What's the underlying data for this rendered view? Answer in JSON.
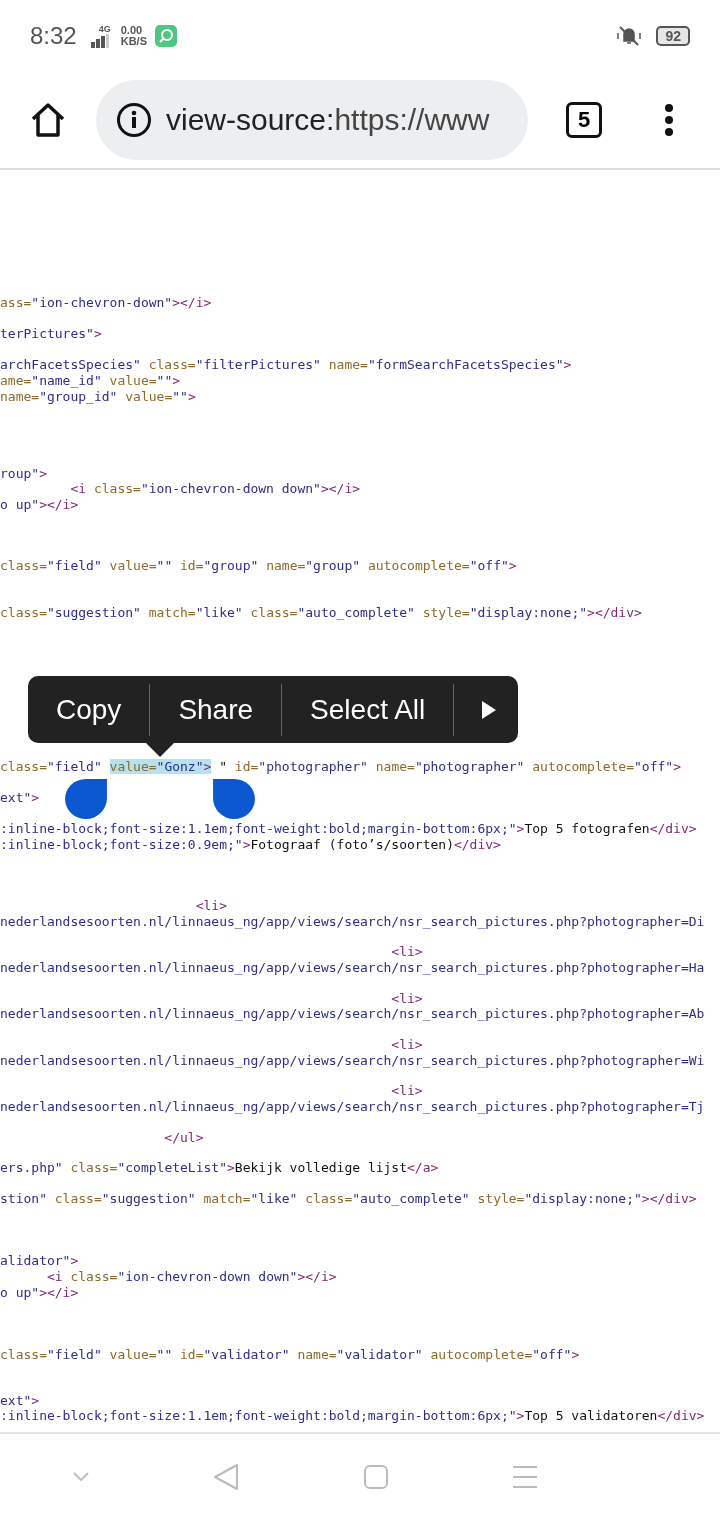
{
  "status_bar": {
    "time": "8:32",
    "network": "4G",
    "speed_value": "0.00",
    "speed_unit": "KB/S",
    "battery": "92"
  },
  "toolbar": {
    "url_scheme": "view-source:",
    "url_rest": "https://www",
    "tab_count": "5"
  },
  "source_lines": [
    {
      "segments": [
        {
          "kind": "attr",
          "text": "ass="
        },
        {
          "kind": "value",
          "text": "\"ion-chevron-down\""
        },
        {
          "kind": "tag",
          "text": "></i>"
        }
      ]
    },
    {
      "segments": [
        {
          "kind": "value",
          "text": "terPictures\""
        },
        {
          "kind": "tag",
          "text": ">"
        }
      ]
    },
    {
      "segments": [
        {
          "kind": "value",
          "text": "archFacetsSpecies\""
        },
        {
          "kind": "attr",
          "text": " class="
        },
        {
          "kind": "value",
          "text": "\"filterPictures\""
        },
        {
          "kind": "attr",
          "text": " name="
        },
        {
          "kind": "value",
          "text": "\"formSearchFacetsSpecies\""
        },
        {
          "kind": "tag",
          "text": ">"
        }
      ]
    },
    {
      "segments": [
        {
          "kind": "attr",
          "text": "ame="
        },
        {
          "kind": "value",
          "text": "\"name_id\""
        },
        {
          "kind": "attr",
          "text": " value="
        },
        {
          "kind": "value",
          "text": "\"\""
        },
        {
          "kind": "tag",
          "text": ">"
        }
      ]
    },
    {
      "segments": [
        {
          "kind": "attr",
          "text": "name="
        },
        {
          "kind": "value",
          "text": "\"group_id\""
        },
        {
          "kind": "attr",
          "text": " value="
        },
        {
          "kind": "value",
          "text": "\"\""
        },
        {
          "kind": "tag",
          "text": ">"
        }
      ]
    },
    {
      "segments": [
        {
          "kind": "value",
          "text": "roup\""
        },
        {
          "kind": "tag",
          "text": ">"
        }
      ]
    },
    {
      "segments": [
        {
          "kind": "tag",
          "text": "         <i"
        },
        {
          "kind": "attr",
          "text": " class="
        },
        {
          "kind": "value",
          "text": "\"ion-chevron-down down\""
        },
        {
          "kind": "tag",
          "text": "></i>"
        }
      ]
    },
    {
      "segments": [
        {
          "kind": "value",
          "text": "o up\""
        },
        {
          "kind": "tag",
          "text": "></i>"
        }
      ]
    },
    {
      "segments": [
        {
          "kind": "attr",
          "text": "class="
        },
        {
          "kind": "value",
          "text": "\"field\""
        },
        {
          "kind": "attr",
          "text": " value="
        },
        {
          "kind": "value",
          "text": "\"\""
        },
        {
          "kind": "attr",
          "text": " id="
        },
        {
          "kind": "value",
          "text": "\"group\""
        },
        {
          "kind": "attr",
          "text": " name="
        },
        {
          "kind": "value",
          "text": "\"group\""
        },
        {
          "kind": "attr",
          "text": " autocomplete="
        },
        {
          "kind": "value",
          "text": "\"off\""
        },
        {
          "kind": "tag",
          "text": ">"
        }
      ]
    },
    {
      "segments": [
        {
          "kind": "attr",
          "text": "class="
        },
        {
          "kind": "value",
          "text": "\"suggestion\""
        },
        {
          "kind": "attr",
          "text": " match="
        },
        {
          "kind": "value",
          "text": "\"like\""
        },
        {
          "kind": "attr",
          "text": " class="
        },
        {
          "kind": "value",
          "text": "\"auto_complete\""
        },
        {
          "kind": "attr",
          "text": " style="
        },
        {
          "kind": "value",
          "text": "\"display:none;\""
        },
        {
          "kind": "tag",
          "text": "></div>"
        }
      ]
    },
    {
      "segments": [
        {
          "kind": "attr",
          "text": "class=",
          "selected": false
        },
        {
          "kind": "value",
          "text": "\"field\" ",
          "selected": false
        },
        {
          "kind": "attr",
          "text": "value=",
          "selected": true
        },
        {
          "kind": "value",
          "text": "\"Gonz\"",
          "selected": true
        },
        {
          "kind": "tag",
          "text": ">",
          "selected": true
        },
        {
          "kind": "text",
          "text": " \" ",
          "selected": false
        },
        {
          "kind": "attr",
          "text": "id=",
          "selected": false
        },
        {
          "kind": "value",
          "text": "\"photographer\"",
          "selected": false
        },
        {
          "kind": "attr",
          "text": " name=",
          "selected": false
        },
        {
          "kind": "value",
          "text": "\"photographer\"",
          "selected": false
        },
        {
          "kind": "attr",
          "text": " autocomplete=",
          "selected": false
        },
        {
          "kind": "value",
          "text": "\"off\"",
          "selected": false
        },
        {
          "kind": "tag",
          "text": ">",
          "selected": false
        }
      ]
    },
    {
      "segments": [
        {
          "kind": "value",
          "text": "ext\""
        },
        {
          "kind": "tag",
          "text": ">"
        }
      ]
    },
    {
      "segments": [
        {
          "kind": "value",
          "text": ":inline-block;font-size:1.1em;font-weight:bold;margin-bottom:6px;\""
        },
        {
          "kind": "tag",
          "text": ">"
        },
        {
          "kind": "text",
          "text": "Top 5 fotografen"
        },
        {
          "kind": "tag",
          "text": "</div>"
        }
      ]
    },
    {
      "segments": [
        {
          "kind": "value",
          "text": ":inline-block;font-size:0.9em;\""
        },
        {
          "kind": "tag",
          "text": ">"
        },
        {
          "kind": "text",
          "text": "Fotograaf (foto’s/soorten)"
        },
        {
          "kind": "tag",
          "text": "</div>"
        }
      ]
    },
    {
      "segments": [
        {
          "kind": "tag",
          "text": "                         <li>"
        }
      ]
    },
    {
      "segments": [
        {
          "kind": "value",
          "text": "nederlandsesoorten.nl/linnaeus_ng/app/views/search/nsr_search_pictures.php?photographer=Di"
        }
      ]
    },
    {
      "segments": [
        {
          "kind": "tag",
          "text": "                                                  <li>"
        }
      ]
    },
    {
      "segments": [
        {
          "kind": "value",
          "text": "nederlandsesoorten.nl/linnaeus_ng/app/views/search/nsr_search_pictures.php?photographer=Ha"
        }
      ]
    },
    {
      "segments": [
        {
          "kind": "tag",
          "text": "                                                  <li>"
        }
      ]
    },
    {
      "segments": [
        {
          "kind": "value",
          "text": "nederlandsesoorten.nl/linnaeus_ng/app/views/search/nsr_search_pictures.php?photographer=Ab"
        }
      ]
    },
    {
      "segments": [
        {
          "kind": "tag",
          "text": "                                                  <li>"
        }
      ]
    },
    {
      "segments": [
        {
          "kind": "value",
          "text": "nederlandsesoorten.nl/linnaeus_ng/app/views/search/nsr_search_pictures.php?photographer=Wi"
        }
      ]
    },
    {
      "segments": [
        {
          "kind": "tag",
          "text": "                                                  <li>"
        }
      ]
    },
    {
      "segments": [
        {
          "kind": "value",
          "text": "nederlandsesoorten.nl/linnaeus_ng/app/views/search/nsr_search_pictures.php?photographer=Tj"
        }
      ]
    },
    {
      "segments": [
        {
          "kind": "tag",
          "text": "                     </ul>"
        }
      ]
    },
    {
      "segments": [
        {
          "kind": "value",
          "text": "ers.php\""
        },
        {
          "kind": "attr",
          "text": " class="
        },
        {
          "kind": "value",
          "text": "\"completeList\""
        },
        {
          "kind": "tag",
          "text": ">"
        },
        {
          "kind": "text",
          "text": "Bekijk volledige lijst"
        },
        {
          "kind": "tag",
          "text": "</a>"
        }
      ]
    },
    {
      "segments": [
        {
          "kind": "value",
          "text": "stion\""
        },
        {
          "kind": "attr",
          "text": " class="
        },
        {
          "kind": "value",
          "text": "\"suggestion\""
        },
        {
          "kind": "attr",
          "text": " match="
        },
        {
          "kind": "value",
          "text": "\"like\""
        },
        {
          "kind": "attr",
          "text": " class="
        },
        {
          "kind": "value",
          "text": "\"auto_complete\""
        },
        {
          "kind": "attr",
          "text": " style="
        },
        {
          "kind": "value",
          "text": "\"display:none;\""
        },
        {
          "kind": "tag",
          "text": "></div>"
        }
      ]
    },
    {
      "segments": [
        {
          "kind": "value",
          "text": "alidator\""
        },
        {
          "kind": "tag",
          "text": ">"
        }
      ]
    },
    {
      "segments": [
        {
          "kind": "tag",
          "text": "      <i"
        },
        {
          "kind": "attr",
          "text": " class="
        },
        {
          "kind": "value",
          "text": "\"ion-chevron-down down\""
        },
        {
          "kind": "tag",
          "text": "></i>"
        }
      ]
    },
    {
      "segments": [
        {
          "kind": "value",
          "text": "o up\""
        },
        {
          "kind": "tag",
          "text": "></i>"
        }
      ]
    },
    {
      "segments": [
        {
          "kind": "attr",
          "text": "class="
        },
        {
          "kind": "value",
          "text": "\"field\""
        },
        {
          "kind": "attr",
          "text": " value="
        },
        {
          "kind": "value",
          "text": "\"\""
        },
        {
          "kind": "attr",
          "text": " id="
        },
        {
          "kind": "value",
          "text": "\"validator\""
        },
        {
          "kind": "attr",
          "text": " name="
        },
        {
          "kind": "value",
          "text": "\"validator\""
        },
        {
          "kind": "attr",
          "text": " autocomplete="
        },
        {
          "kind": "value",
          "text": "\"off\""
        },
        {
          "kind": "tag",
          "text": ">"
        }
      ]
    },
    {
      "segments": [
        {
          "kind": "value",
          "text": "ext\""
        },
        {
          "kind": "tag",
          "text": ">"
        }
      ]
    },
    {
      "segments": [
        {
          "kind": "value",
          "text": ":inline-block;font-size:1.1em;font-weight:bold;margin-bottom:6px;\""
        },
        {
          "kind": "tag",
          "text": ">"
        },
        {
          "kind": "text",
          "text": "Top 5 validatoren"
        },
        {
          "kind": "tag",
          "text": "</div>"
        }
      ]
    }
  ],
  "context_menu": {
    "items": [
      "Copy",
      "Share",
      "Select All"
    ]
  }
}
